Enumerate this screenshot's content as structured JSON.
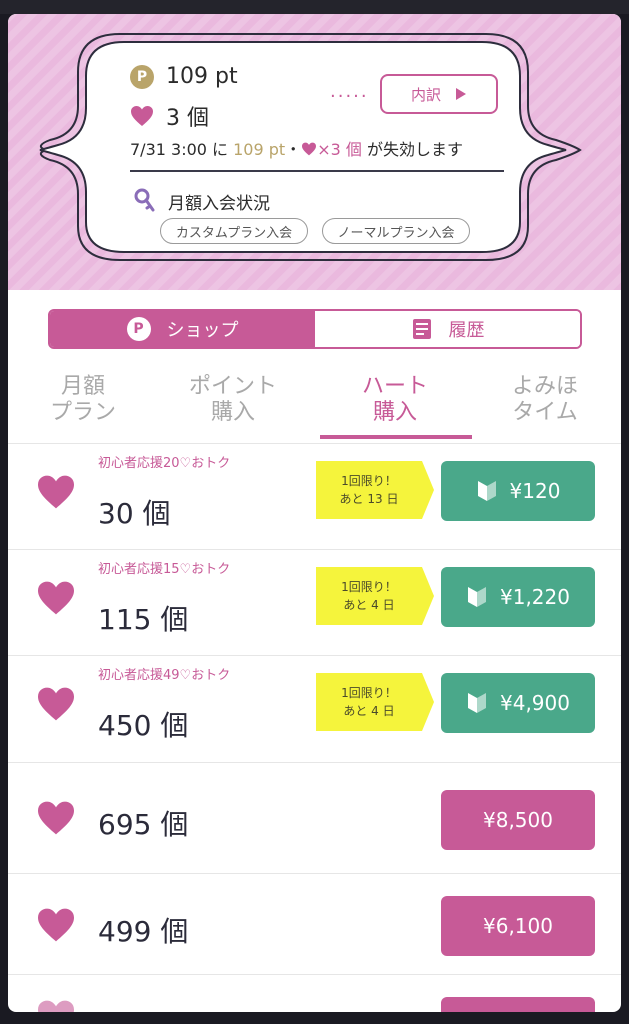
{
  "header": {
    "points": "109 pt",
    "hearts": "3 個",
    "detail_label": "内訳",
    "dots": "·····",
    "expire": {
      "date": "7/31 3:00 に ",
      "points": "109 pt",
      "sep": "・",
      "hearts": "×3 個",
      "suffix": " が失効します"
    },
    "membership_label": "月額入会状況",
    "plans": [
      "カスタムプラン入会",
      "ノーマルプラン入会"
    ]
  },
  "segment": {
    "shop": "ショップ",
    "history": "履歴"
  },
  "tabs": [
    "月額\nプラン",
    "ポイント\n購入",
    "ハート\n購入",
    "よみほ\nタイム"
  ],
  "products": [
    {
      "promo": "初心者応援20♡おトク",
      "count": "30 個",
      "tag_line1": "1回限り！",
      "tag_line2": "あと 13 日",
      "price": "¥120"
    },
    {
      "promo": "初心者応援15♡おトク",
      "count": "115 個",
      "tag_line1": "1回限り！",
      "tag_line2": "あと 4 日",
      "price": "¥1,220"
    },
    {
      "promo": "初心者応援49♡おトク",
      "count": "450 個",
      "tag_line1": "1回限り！",
      "tag_line2": "あと 4 日",
      "price": "¥4,900"
    },
    {
      "count": "695 個",
      "price": "¥8,500"
    },
    {
      "count": "499 個",
      "price": "¥6,100"
    }
  ],
  "colors": {
    "accent": "#c75a97",
    "green_button": "#4aa88a",
    "tag_yellow": "#f5f43c",
    "gold": "#b9a46a",
    "hero_bg": "#eab9de"
  }
}
